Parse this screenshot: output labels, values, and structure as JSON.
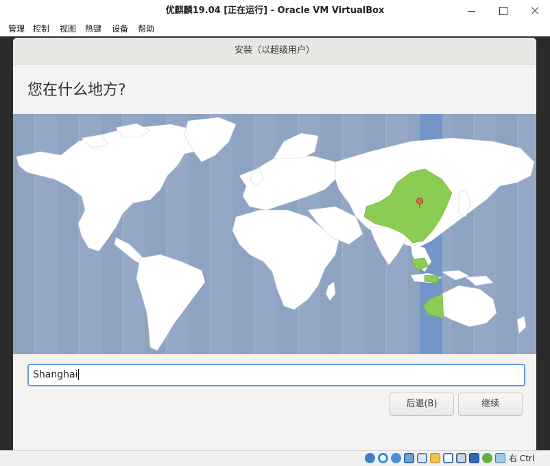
{
  "window": {
    "title": "优麒麟19.04 [正在运行] - Oracle VM VirtualBox"
  },
  "menubar": {
    "items": [
      "管理",
      "控制",
      "视图",
      "热键",
      "设备",
      "帮助"
    ]
  },
  "installer": {
    "header": "安装（以超级用户）",
    "question": "您在什么地方?",
    "timezone_input": {
      "value": "Shanghai",
      "placeholder": ""
    },
    "back_button": "后退(B)",
    "continue_button": "继续",
    "selected_city": "Shanghai"
  },
  "statusbar": {
    "host_key": "右 Ctrl",
    "icons": [
      "hard-disk-icon",
      "optical-drive-icon",
      "audio-icon",
      "network-icon",
      "usb-icon",
      "shared-folders-icon",
      "display-icon",
      "video-capture-icon",
      "virtualization-icon",
      "mouse-integration-icon",
      "keyboard-capture-icon"
    ]
  },
  "colors": {
    "map_ocean": "#94a8c6",
    "land": "#ffffff",
    "selected_zone_land": "#8acd52",
    "selected_zone_band": "#7395c8",
    "focus_border": "#5d9de8"
  }
}
